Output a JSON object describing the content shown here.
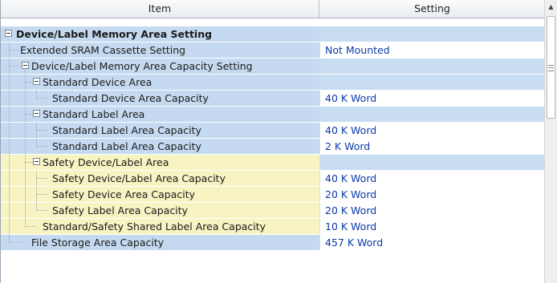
{
  "header": {
    "item": "Item",
    "setting": "Setting"
  },
  "rows": [
    {
      "label": "Device/Label Memory Area Setting",
      "setting": ""
    },
    {
      "label": "Extended SRAM Cassette Setting",
      "setting": "Not Mounted"
    },
    {
      "label": "Device/Label Memory Area Capacity Setting",
      "setting": ""
    },
    {
      "label": "Standard Device Area",
      "setting": ""
    },
    {
      "label": "Standard Device Area Capacity",
      "setting": "40 K Word"
    },
    {
      "label": "Standard Label Area",
      "setting": ""
    },
    {
      "label": "Standard Label Area Capacity",
      "setting": "40 K Word"
    },
    {
      "label": "Standard Label Area Capacity",
      "setting": "2 K Word"
    },
    {
      "label": "Safety Device/Label Area",
      "setting": ""
    },
    {
      "label": "Safety Device/Label Area Capacity",
      "setting": "40 K Word"
    },
    {
      "label": "Safety Device Area Capacity",
      "setting": "20 K Word"
    },
    {
      "label": "Safety Label Area Capacity",
      "setting": "20 K Word"
    },
    {
      "label": "Standard/Safety Shared Label Area Capacity",
      "setting": "10 K Word"
    },
    {
      "label": "File Storage Area Capacity",
      "setting": "457 K Word"
    }
  ],
  "scrollbar": {
    "up_arrow": "▲"
  }
}
